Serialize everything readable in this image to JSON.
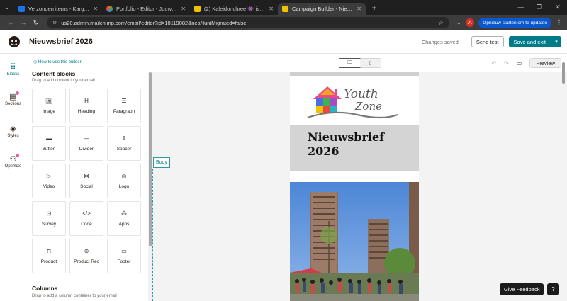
{
  "browser": {
    "tabs": [
      {
        "title": "Verzonden items - Kargbo Abd",
        "color": "#1a73e8"
      },
      {
        "title": "Portfolio - Editor - JouwWeb",
        "color": "#e8710a"
      },
      {
        "title": "(2) Kaleidonchree 👾 is aan het",
        "color": "#f2c200"
      },
      {
        "title": "Campaign Builder - Nieuwsbrief",
        "color": "#f2c200"
      }
    ],
    "url": "us20.admin.mailchimp.com/email/editor?id=18119082&neaNuniMigrated=false",
    "profile_initial": "A",
    "update_label": "Opnieuw starten om te updaten"
  },
  "header": {
    "campaign_title": "Nieuwsbrief 2026",
    "status": "Changes saved",
    "send_test": "Send test",
    "save_exit": "Save and exit"
  },
  "rail": {
    "items": [
      {
        "label": "Blocks",
        "icon": "grid-icon"
      },
      {
        "label": "Sections",
        "icon": "sections-icon"
      },
      {
        "label": "Styles",
        "icon": "paint-icon"
      },
      {
        "label": "Optimize",
        "icon": "optimize-icon"
      }
    ]
  },
  "panel": {
    "how_to": "How to use this builder",
    "content_heading": "Content blocks",
    "content_sub": "Drag to add content to your email",
    "blocks": [
      {
        "label": "Image",
        "icon": "🖼"
      },
      {
        "label": "Heading",
        "icon": "H"
      },
      {
        "label": "Paragraph",
        "icon": "☰"
      },
      {
        "label": "Button",
        "icon": "▬"
      },
      {
        "label": "Divider",
        "icon": "—"
      },
      {
        "label": "Spacer",
        "icon": "⇕"
      },
      {
        "label": "Video",
        "icon": "▷"
      },
      {
        "label": "Social",
        "icon": "⋈"
      },
      {
        "label": "Logo",
        "icon": "◎"
      },
      {
        "label": "Survey",
        "icon": "⊡"
      },
      {
        "label": "Code",
        "icon": "</>"
      },
      {
        "label": "Apps",
        "icon": "⁂"
      },
      {
        "label": "Product",
        "icon": "⊓"
      },
      {
        "label": "Product Rec",
        "icon": "⊕"
      },
      {
        "label": "Footer",
        "icon": "▭"
      }
    ],
    "columns_heading": "Columns",
    "columns_sub": "Drag to add a column container to your email"
  },
  "toolbar": {
    "preview": "Preview"
  },
  "email": {
    "logo_text_1": "Youth",
    "logo_text_2": "Zone",
    "title_line1": "Nieuwsbrief",
    "title_line2": "2026"
  },
  "body_label": "Body",
  "feedback": "Give Feedback",
  "help": "?"
}
